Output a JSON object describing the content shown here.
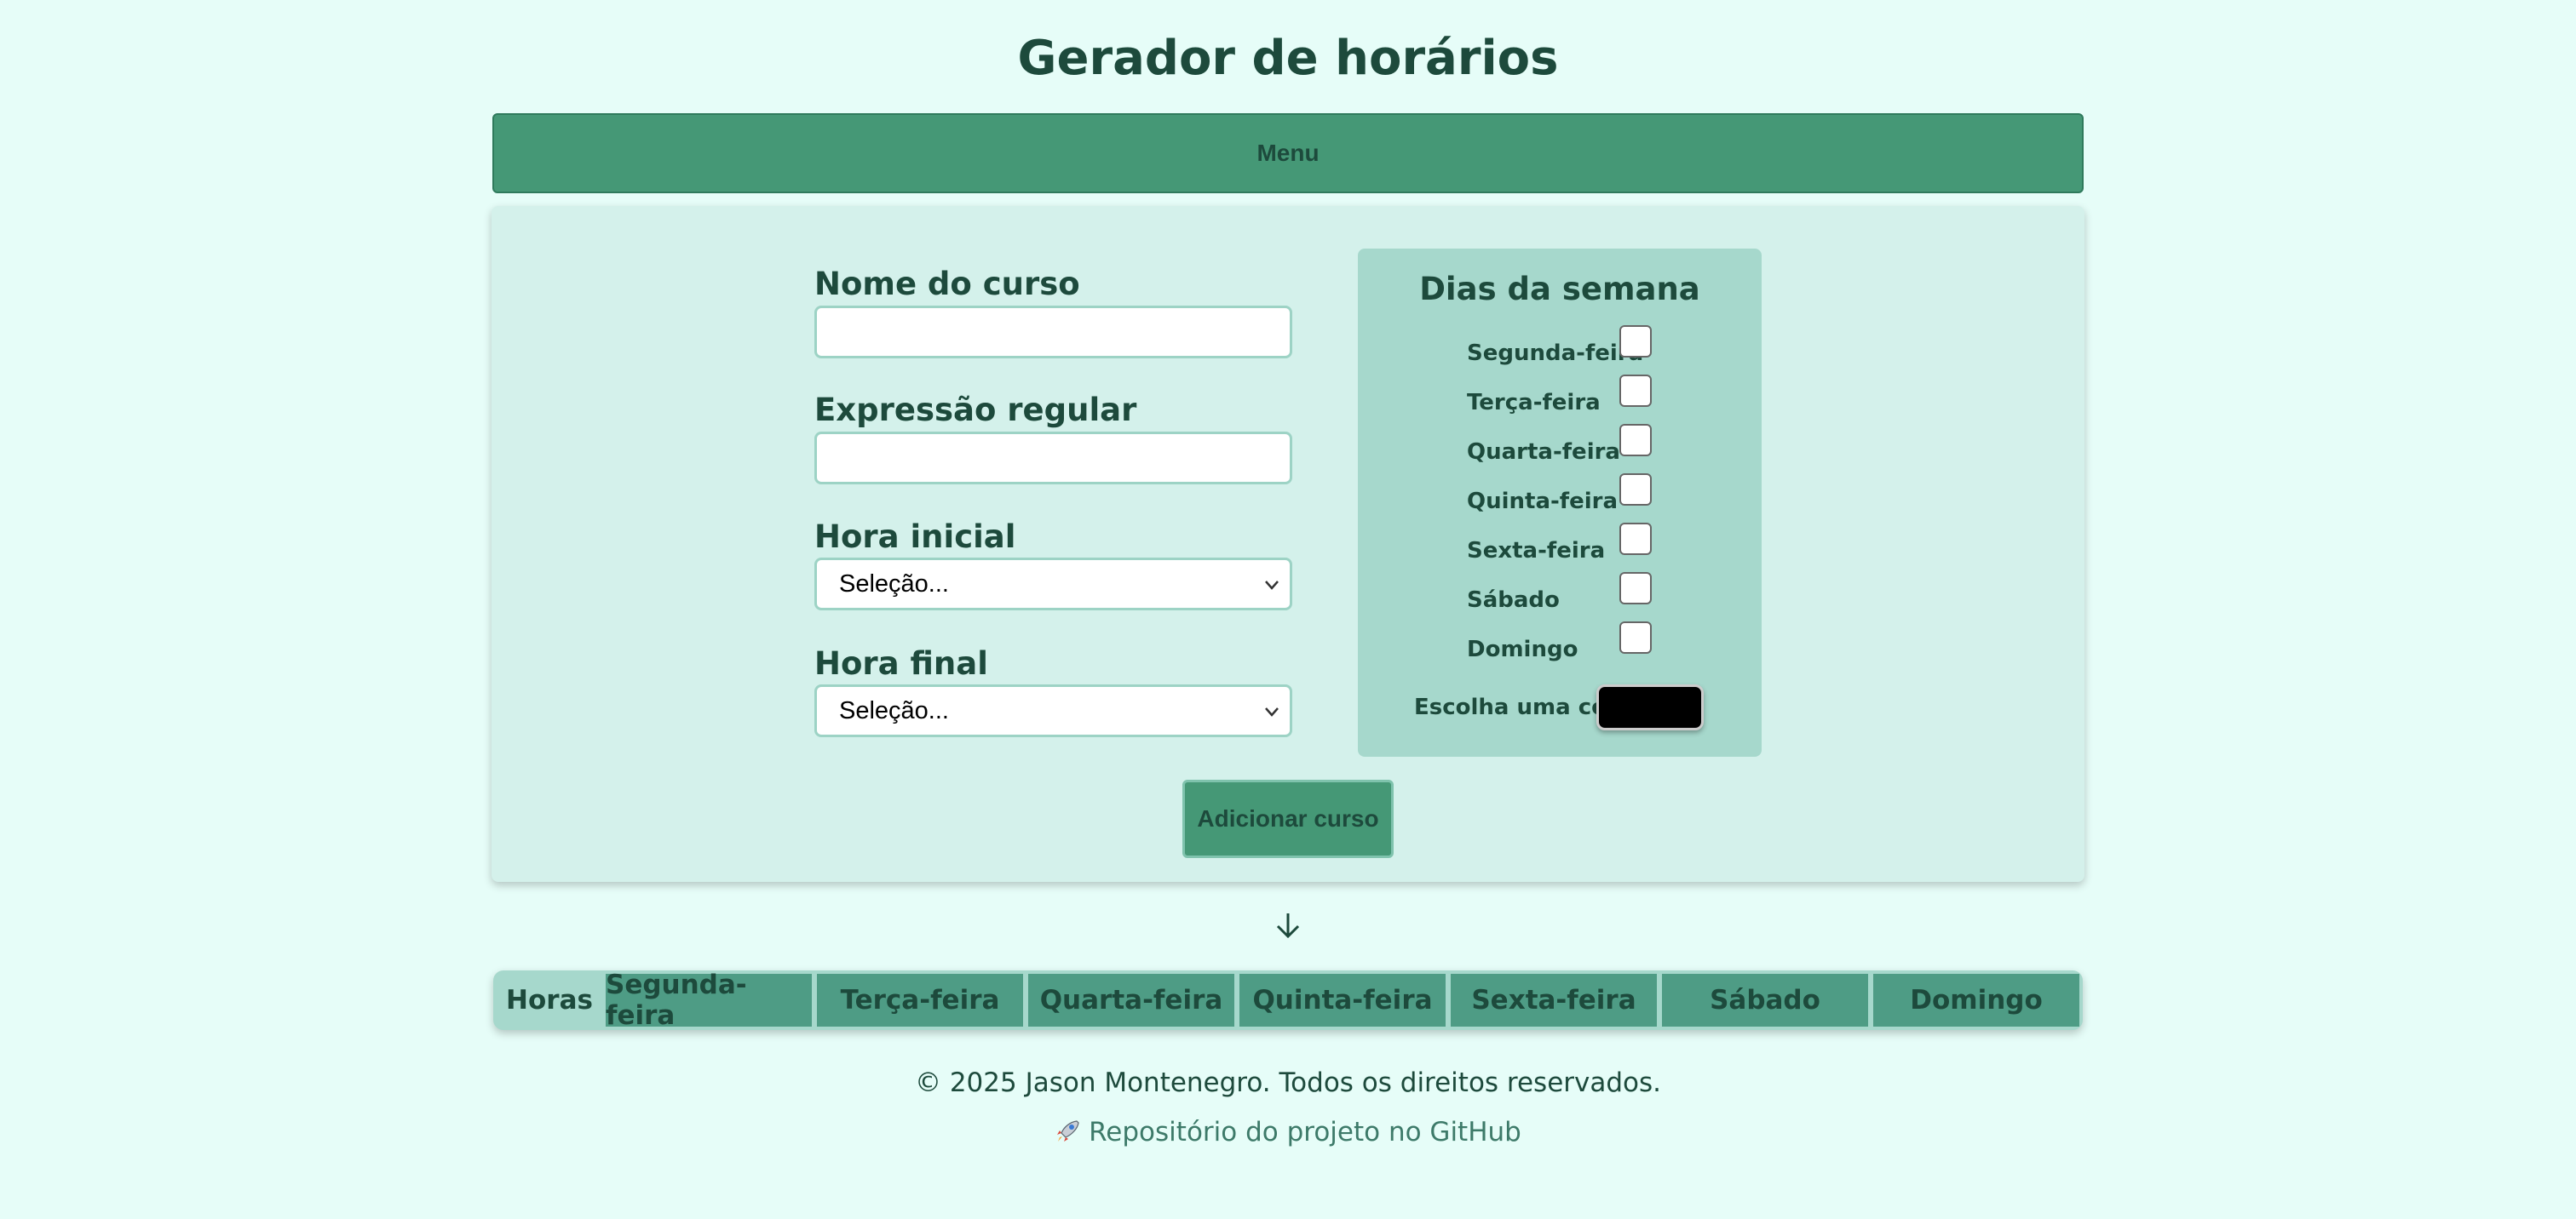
{
  "header": {
    "title": "Gerador de horários"
  },
  "menu": {
    "label": "Menu"
  },
  "form": {
    "course_name": {
      "label": "Nome do curso",
      "value": "",
      "placeholder": ""
    },
    "regex": {
      "label": "Expressão regular",
      "value": "",
      "placeholder": ""
    },
    "start_time": {
      "label": "Hora inicial",
      "selected": "Seleção..."
    },
    "end_time": {
      "label": "Hora final",
      "selected": "Seleção..."
    },
    "add_button": "Adicionar curso"
  },
  "weekdays_panel": {
    "title": "Dias da semana",
    "days": [
      {
        "label": "Segunda-feira",
        "checked": false
      },
      {
        "label": "Terça-feira",
        "checked": false
      },
      {
        "label": "Quarta-feira",
        "checked": false
      },
      {
        "label": "Quinta-feira",
        "checked": false
      },
      {
        "label": "Sexta-feira",
        "checked": false
      },
      {
        "label": "Sábado",
        "checked": false
      },
      {
        "label": "Domingo",
        "checked": false
      }
    ],
    "color_label": "Escolha uma cor",
    "color_value": "#000000"
  },
  "schedule": {
    "headers": [
      "Horas",
      "Segunda-feira",
      "Terça-feira",
      "Quarta-feira",
      "Quinta-feira",
      "Sexta-feira",
      "Sábado",
      "Domingo"
    ]
  },
  "footer": {
    "copyright": "© 2025 Jason Montenegro. Todos os direitos reservados.",
    "repo_link": "Repositório do projeto no GitHub"
  },
  "colors": {
    "background": "#e6fdf8",
    "accent": "#459876",
    "text": "#1d4a3c"
  }
}
